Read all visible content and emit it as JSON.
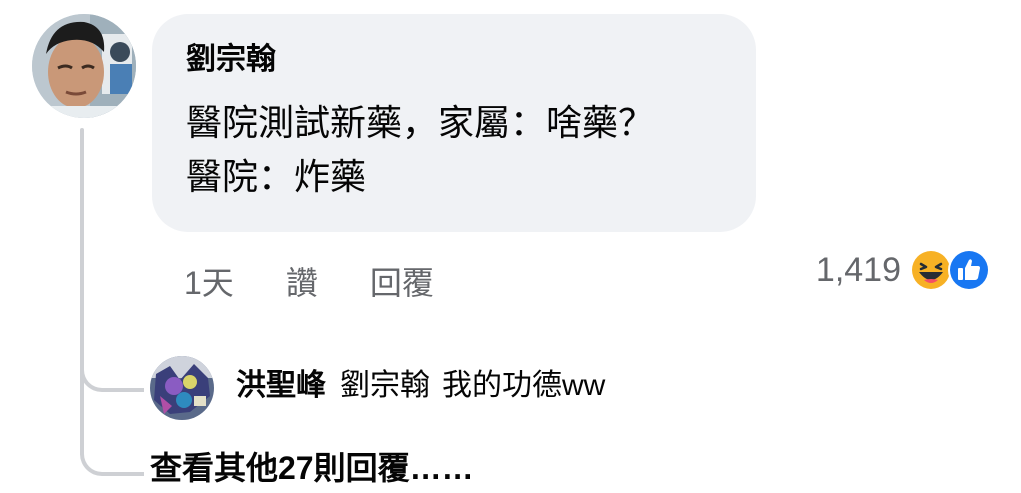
{
  "comment": {
    "author": "劉宗翰",
    "lines": [
      "醫院測試新藥，家屬：啥藥？",
      "醫院：炸藥"
    ],
    "timestamp": "1天",
    "like_label": "讚",
    "reply_label": "回覆",
    "reaction_count": "1,419",
    "reactions": [
      "haha-icon",
      "like-icon"
    ]
  },
  "reply": {
    "author": "洪聖峰",
    "mention": "劉宗翰",
    "text": "我的功德ww"
  },
  "view_more": "查看其他27則回覆……",
  "colors": {
    "bubble": "#f0f2f5",
    "secondary_text": "#65676b",
    "like_blue": "#1877f2",
    "haha_yellow": "#f7b125",
    "thread_line": "#ced0d4"
  }
}
